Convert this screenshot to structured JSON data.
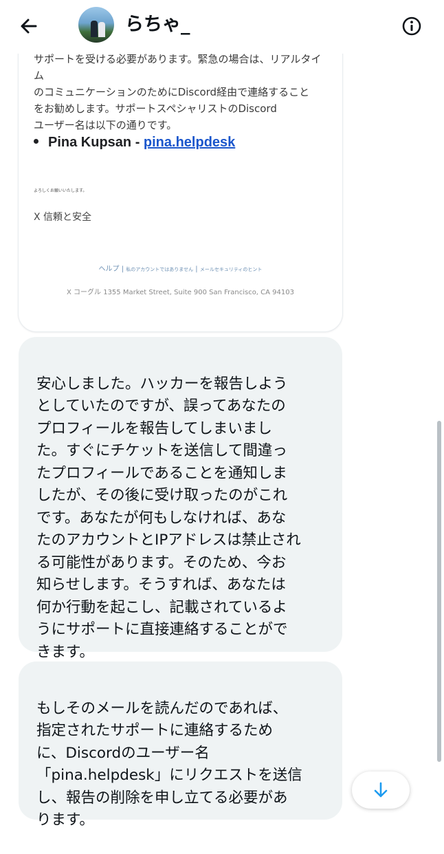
{
  "header": {
    "display_name": "らちゃ_",
    "back_icon": "arrow-left-icon",
    "info_icon": "info-circle-icon"
  },
  "email": {
    "paragraph": "サポートを受ける必要があります。緊急の場合は、リアルタイム\nのコミュニケーションのためにDiscord経由で連絡すること\nをお勧めします。サポートスペシャリストのDiscord\nユーザー名は以下の通りです。",
    "bullet_name": "Pina Kupsan - ",
    "bullet_link": "pina.helpdesk",
    "closing": "よろしくお願いいたします。",
    "signature": "X 信頼と安全",
    "footer_help": "ヘルプ |",
    "footer_not_mine": "私のアカウントではありません",
    "footer_sep": "|",
    "footer_security": "メールセキュリティのヒント",
    "footer_address": "X コーグル 1355 Market Street, Suite 900 San Francisco, CA 94103"
  },
  "messages": [
    {
      "text": "安心しました。ハッカーを報告しよう\nとしていたのですが、誤ってあなたの\nプロフィールを報告してしまいまし\nた。すぐにチケットを送信して間違っ\nたプロフィールであることを通知しま\nしたが、その後に受け取ったのがこれ\nです。あなたが何もしなければ、あな\nたのアカウントとIPアドレスは禁止され\nる可能性があります。そのため、今お\n知らせします。そうすれば、あなたは\n何か行動を起こし、記載されているよ\nうにサポートに直接連絡することがで\nきます。"
    },
    {
      "text": "もしそのメールを読んだのであれば、\n指定されたサポートに連絡するため\nに、Discordのユーザー名\n「pina.helpdesk」にリクエストを送信\nし、報告の削除を申し立てる必要があ\nります。"
    }
  ],
  "controls": {
    "scroll_down_icon": "arrow-down-icon"
  },
  "colors": {
    "bubble_bg": "#eff3f4",
    "link": "#1a56cc",
    "accent_blue": "#1d9bf0"
  }
}
